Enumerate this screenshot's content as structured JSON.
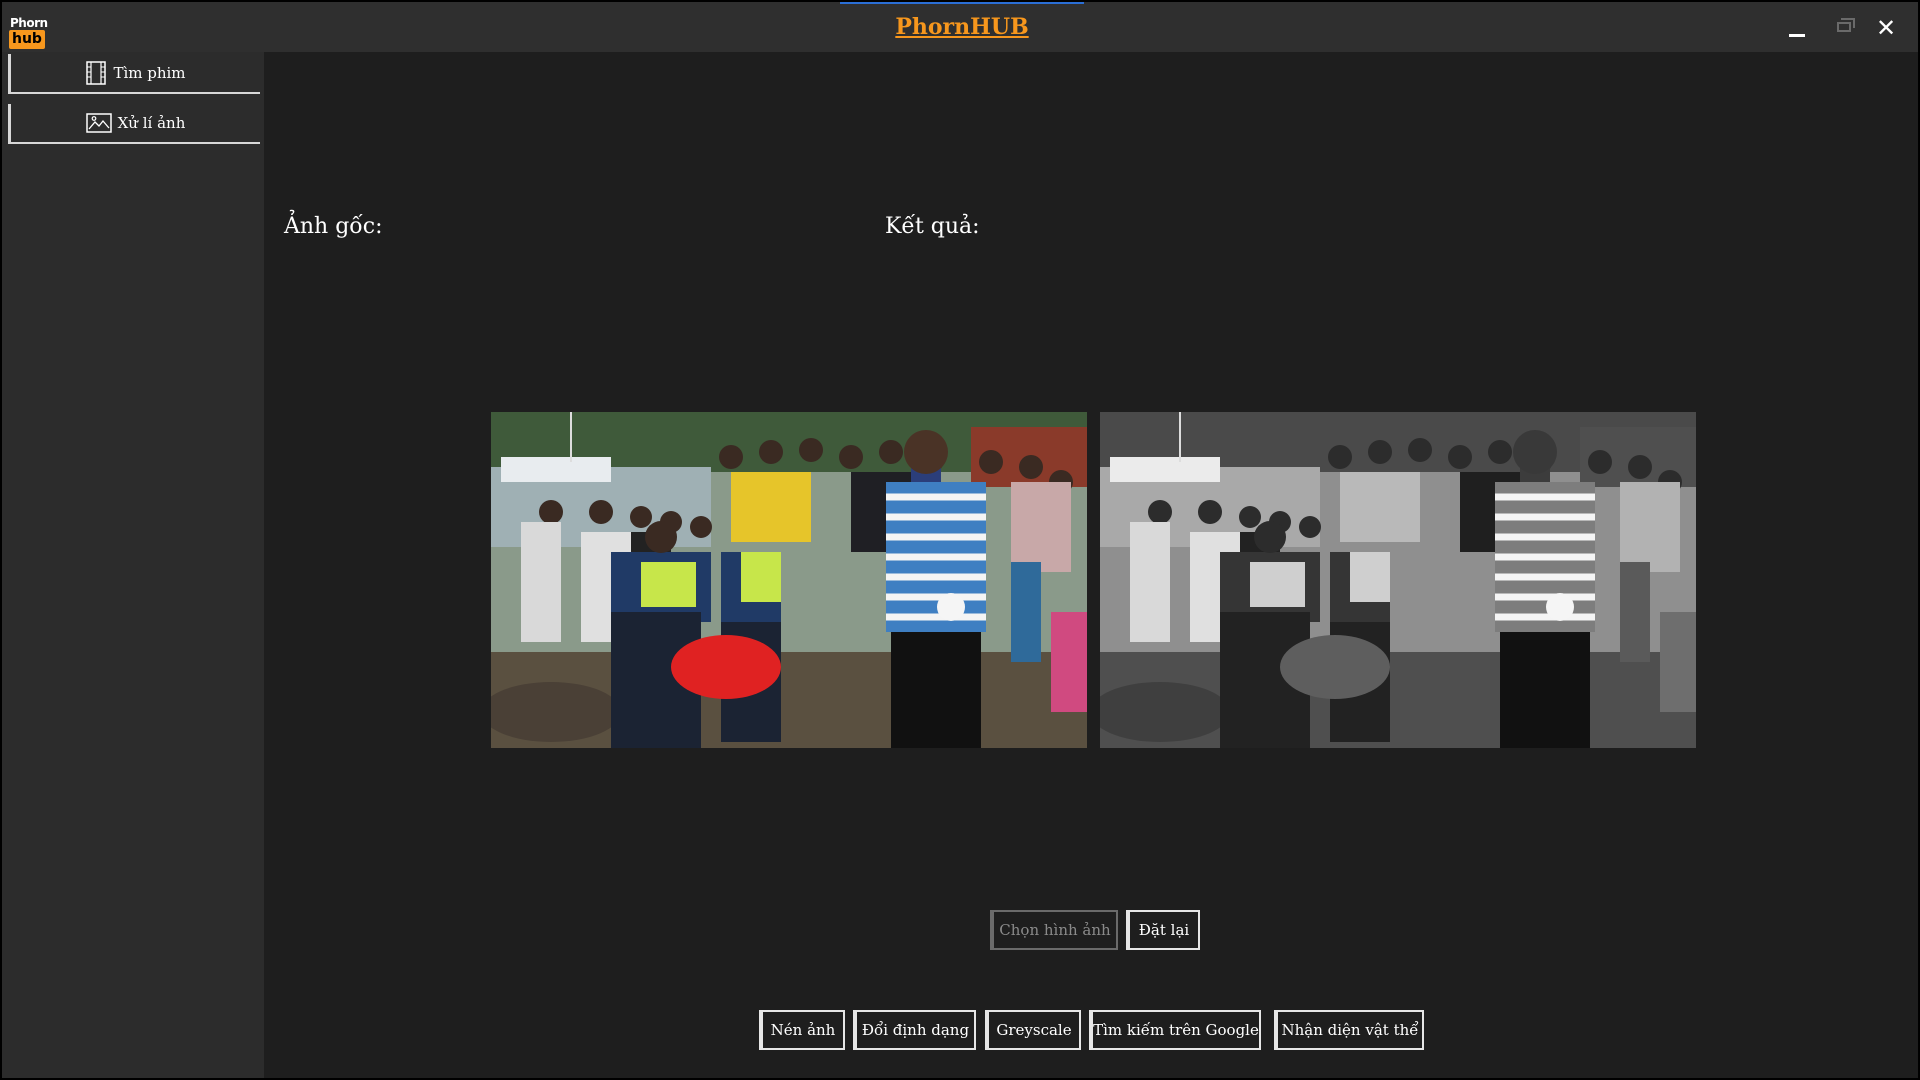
{
  "window": {
    "title": "PhornHUB",
    "logo_top": "Phorn",
    "logo_bottom": "hub",
    "close_glyph": "✕"
  },
  "sidebar": {
    "items": [
      {
        "label": "Tìm phim",
        "icon": "film-icon"
      },
      {
        "label": "Xử lí ảnh",
        "icon": "image-icon"
      }
    ]
  },
  "main": {
    "original_label": "Ảnh gốc:",
    "result_label": "Kết quả:",
    "choose_image_button": "Chọn hình ảnh",
    "reset_button": "Đặt lại",
    "actions": [
      "Nén ảnh",
      "Đổi định dạng",
      "Greyscale",
      "Tìm kiếm trên Google",
      "Nhận diện vật thể"
    ]
  },
  "colors": {
    "accent": "#f7971d",
    "background": "#1e1e1e",
    "sidebar": "#2c2c2c",
    "titlebar": "#2f2f2f"
  }
}
